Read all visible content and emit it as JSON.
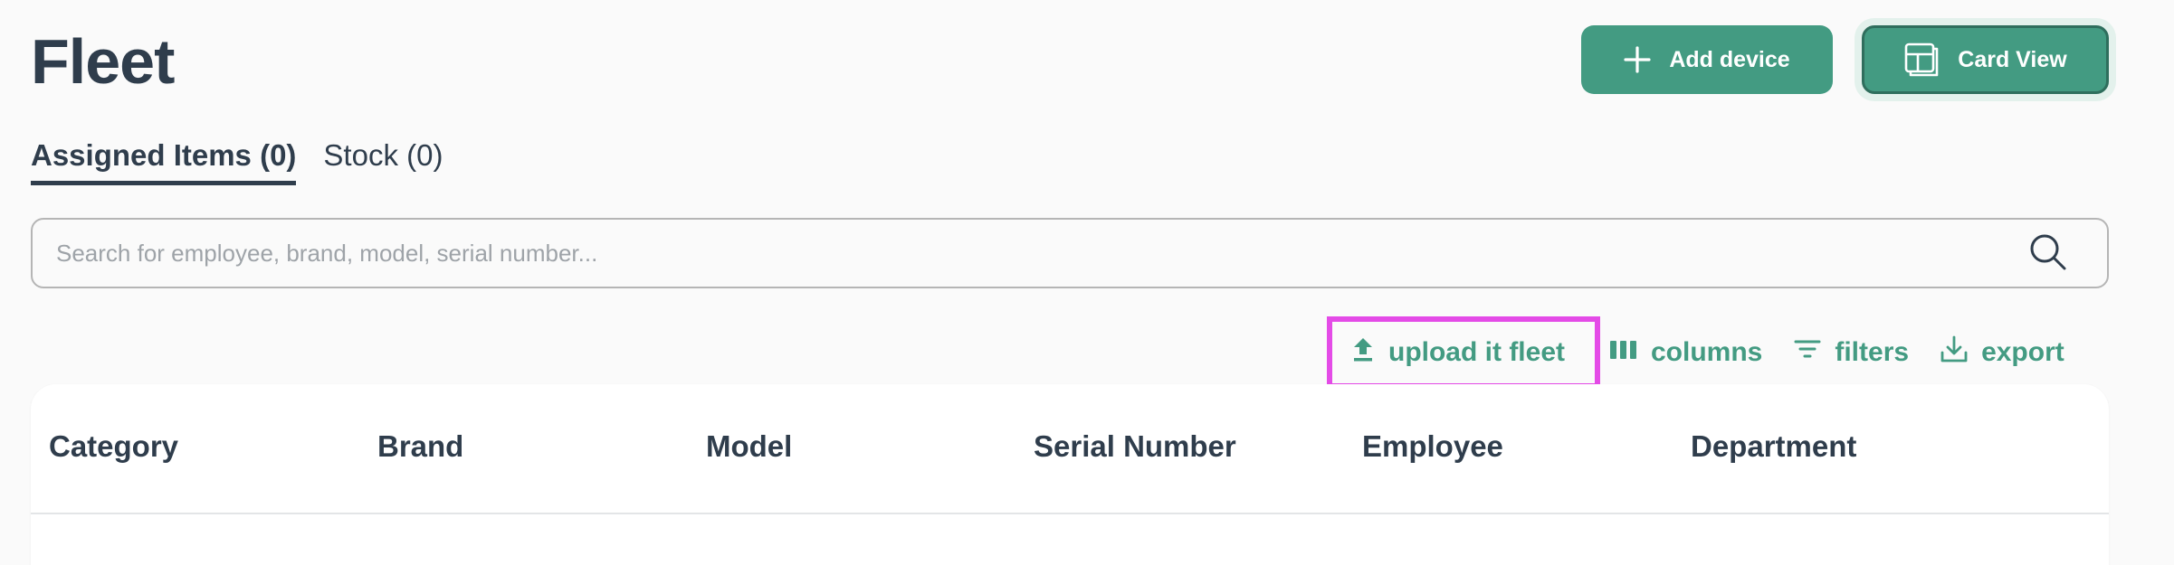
{
  "page": {
    "title": "Fleet"
  },
  "header": {
    "add_device_label": "Add device",
    "card_view_label": "Card View"
  },
  "tabs": [
    {
      "label": "Assigned Items (0)",
      "active": true
    },
    {
      "label": "Stock (0)",
      "active": false
    }
  ],
  "search": {
    "placeholder": "Search for employee, brand, model, serial number...",
    "value": ""
  },
  "actions": {
    "upload_label": "upload it fleet",
    "columns_label": "columns",
    "filters_label": "filters",
    "export_label": "export"
  },
  "table": {
    "columns": [
      "Category",
      "Brand",
      "Model",
      "Serial Number",
      "Employee",
      "Department"
    ]
  },
  "colors": {
    "accent": "#439b82",
    "text": "#2f3d4c",
    "highlight": "#e44be7",
    "background": "#fafafa"
  },
  "icons": [
    "plus-icon",
    "card-view-icon",
    "search-icon",
    "upload-icon",
    "columns-icon",
    "filter-icon",
    "download-icon"
  ]
}
